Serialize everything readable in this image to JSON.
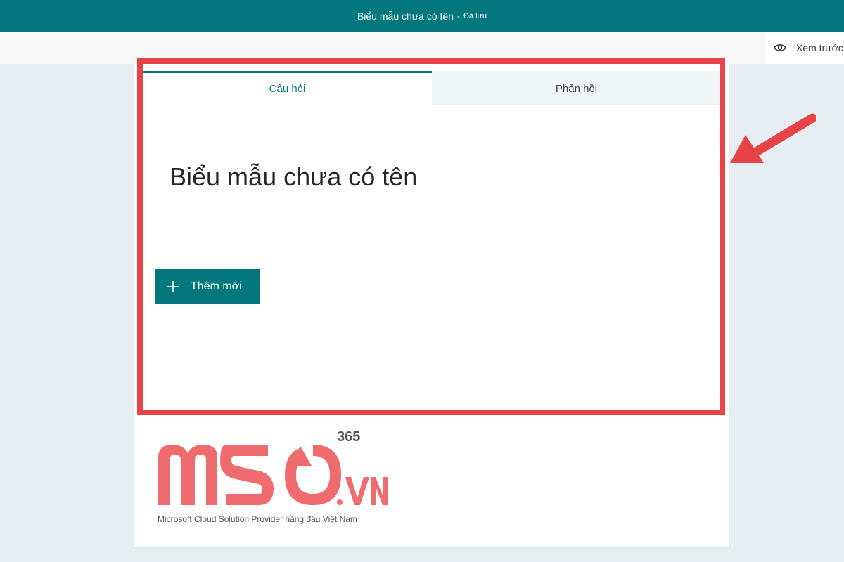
{
  "header": {
    "title": "Biểu mẫu chưa có tên",
    "separator": "-",
    "status": "Đã lưu"
  },
  "toolbar": {
    "preview_label": "Xem trước"
  },
  "tabs": [
    {
      "label": "Câu hỏi",
      "active": true
    },
    {
      "label": "Phản hồi",
      "active": false
    }
  ],
  "form": {
    "title": "Biểu mẫu chưa có tên",
    "add_new_label": "Thêm mới"
  },
  "watermark": {
    "brand": "MSO",
    "suffix": ".VN",
    "superscript": "365",
    "tagline": "Microsoft Cloud Solution Provider hàng đầu Việt Nam"
  },
  "colors": {
    "accent": "#03787c",
    "highlight": "#e84448",
    "logo": "#ef6b6e",
    "background": "#e6eef1"
  },
  "icons": {
    "preview": "eye-icon",
    "add": "plus-icon",
    "annotation": "arrow-icon"
  }
}
